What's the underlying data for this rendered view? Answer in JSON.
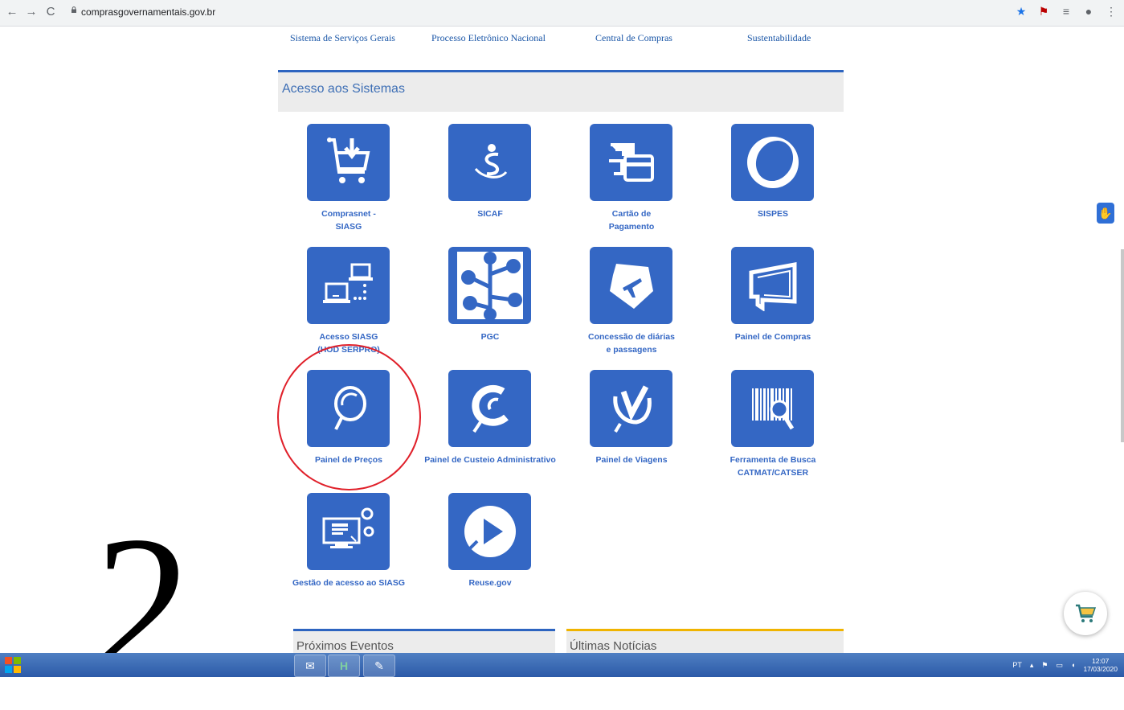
{
  "browser": {
    "url": "comprasgovernamentais.gov.br",
    "back": "←",
    "forward": "→",
    "reload": "C",
    "right_icons": [
      "★",
      "⚑",
      "≡",
      "●",
      "⋮"
    ]
  },
  "top_links": [
    "Sistema de Serviços Gerais",
    "Processo Eletrônico Nacional",
    "Central de Compras",
    "Sustentabilidade"
  ],
  "section": {
    "title": "Acesso aos Sistemas"
  },
  "tiles": [
    {
      "label": "Compras­net - SIASG",
      "icon": "cart-download-icon"
    },
    {
      "label": "SICAF",
      "icon": "sicaf-icon"
    },
    {
      "label": "Cartão de Pagamento",
      "icon": "card-payment-icon"
    },
    {
      "label": "SISPES",
      "icon": "sispes-ring-icon"
    },
    {
      "label": "Acesso SIASG (HOD SERPRO)",
      "icon": "network-computers-icon"
    },
    {
      "label": "PGC",
      "icon": "pgc-tree-icon"
    },
    {
      "label": "Concessão de diárias e passagens",
      "icon": "plane-badge-icon"
    },
    {
      "label": "Painel de Compras",
      "icon": "panel-screen-icon"
    },
    {
      "label": "Painel de Preços",
      "icon": "search-ring-icon"
    },
    {
      "label": "Painel de Custeio Administrativo",
      "icon": "custeio-icon"
    },
    {
      "label": "Painel de Viagens",
      "icon": "viagens-icon"
    },
    {
      "label": "Ferramenta de Busca CATMAT/CATSER",
      "icon": "barcode-search-icon"
    },
    {
      "label": "Gestão de acesso ao SIASG",
      "icon": "gear-screen-icon"
    },
    {
      "label": "Reuse.gov",
      "icon": "play-icon"
    }
  ],
  "annotation": {
    "number": "2"
  },
  "bottom": {
    "left_title": "Próximos Eventos",
    "right_title": "Últimas Notícias"
  },
  "taskbar": {
    "lang": "PT",
    "time": "12:07",
    "date": "17/03/2020"
  },
  "colors": {
    "tile": "#3467c4",
    "accent_blue": "#2d64c0",
    "accent_yellow": "#f0b400",
    "annotation": "#e0202a"
  }
}
